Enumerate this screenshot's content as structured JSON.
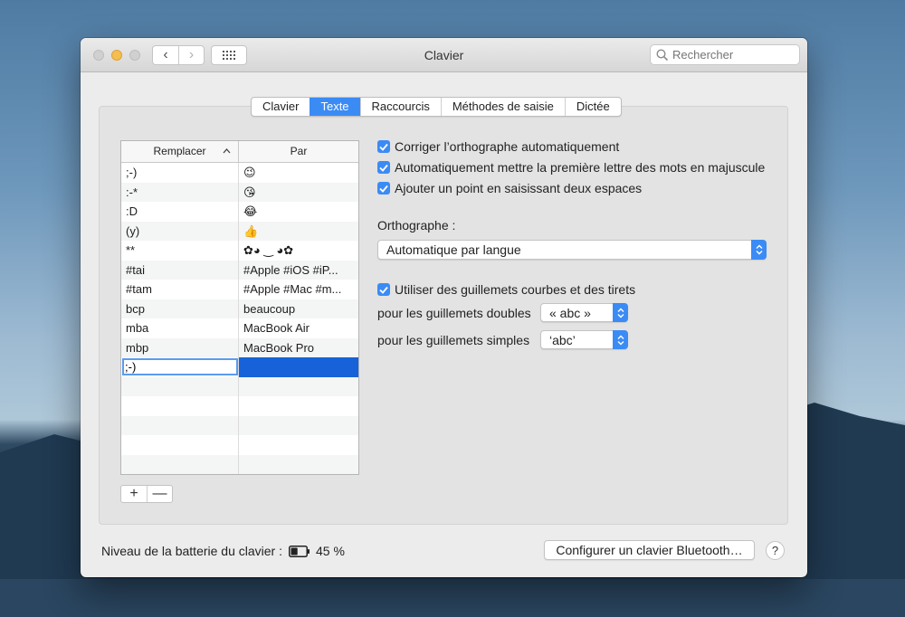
{
  "window": {
    "title": "Clavier",
    "search_placeholder": "Rechercher"
  },
  "tabs": [
    {
      "label": "Clavier",
      "active": false
    },
    {
      "label": "Texte",
      "active": true
    },
    {
      "label": "Raccourcis",
      "active": false
    },
    {
      "label": "Méthodes de saisie",
      "active": false
    },
    {
      "label": "Dictée",
      "active": false
    }
  ],
  "table": {
    "col_replace": "Remplacer",
    "col_with": "Par",
    "rows": [
      {
        "replace": ";-)",
        "with": "😉"
      },
      {
        "replace": ":-*",
        "with": "😘"
      },
      {
        "replace": ":D",
        "with": "😂"
      },
      {
        "replace": "(y)",
        "with": "👍"
      },
      {
        "replace": "**",
        "with": "✿◕ ‿ ◕✿"
      },
      {
        "replace": "#tai",
        "with": "#Apple #iOS #iP..."
      },
      {
        "replace": "#tam",
        "with": "#Apple #Mac #m..."
      },
      {
        "replace": "bcp",
        "with": "beaucoup"
      },
      {
        "replace": "mba",
        "with": "MacBook Air"
      },
      {
        "replace": "mbp",
        "with": "MacBook Pro"
      }
    ],
    "editing_value": ";-)",
    "add_label": "+",
    "remove_label": "—"
  },
  "options": {
    "autocorrect": "Corriger l’orthographe automatiquement",
    "capitalize": "Automatiquement mettre la première lettre des mots en majuscule",
    "double_space": "Ajouter un point en saisissant deux espaces",
    "spelling_label": "Orthographe :",
    "spelling_value": "Automatique par langue",
    "smart_quotes": "Utiliser des guillemets courbes et des tirets",
    "double_quotes_label": "pour les guillemets doubles",
    "double_quotes_value": "« abc »",
    "single_quotes_label": "pour les guillemets simples",
    "single_quotes_value": "‘abc’"
  },
  "footer": {
    "battery_label": "Niveau de la batterie du clavier :",
    "battery_value": "45 %",
    "battery_level": 0.45,
    "bluetooth_button": "Configurer un clavier Bluetooth…",
    "help": "?"
  },
  "colors": {
    "accent": "#3b8bf5",
    "selection": "#1762d8"
  }
}
